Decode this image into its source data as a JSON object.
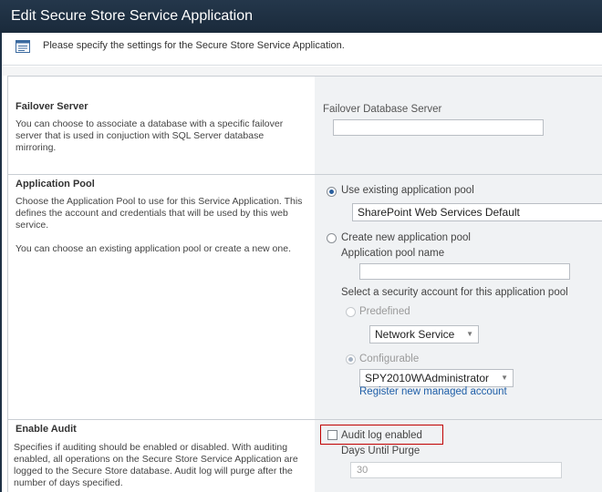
{
  "window": {
    "title": "Edit Secure Store Service Application"
  },
  "info": {
    "text": "Please specify the settings for the Secure Store Service Application."
  },
  "failover": {
    "title": "Failover Server",
    "description": "You can choose to associate a database with a specific failover server that is used in conjuction with SQL Server database mirroring.",
    "field_label": "Failover Database Server",
    "field_value": ""
  },
  "app_pool": {
    "title": "Application Pool",
    "description_1": "Choose the Application Pool to use for this Service Application. This defines the account and credentials that will be used by this web service.",
    "description_2": "You can choose an existing application pool or create a new one.",
    "use_existing_label": "Use existing application pool",
    "existing_pool_value": "SharePoint Web Services Default",
    "create_new_label": "Create new application pool",
    "pool_name_label": "Application pool name",
    "pool_name_value": "",
    "security_account_label": "Select a security account for this application pool",
    "predefined_label": "Predefined",
    "predefined_value": "Network Service",
    "configurable_label": "Configurable",
    "configurable_value": "SPY2010W\\Administrator",
    "register_link": "Register new managed account"
  },
  "audit": {
    "title": "Enable Audit",
    "description": "Specifies if auditing should be enabled or disabled. With auditing enabled, all operations on the Secure Store Service Application are logged to the Secure Store database. Audit log will purge after the number of days specified.",
    "checkbox_label": "Audit log enabled",
    "days_label": "Days Until Purge",
    "days_value": "30"
  }
}
